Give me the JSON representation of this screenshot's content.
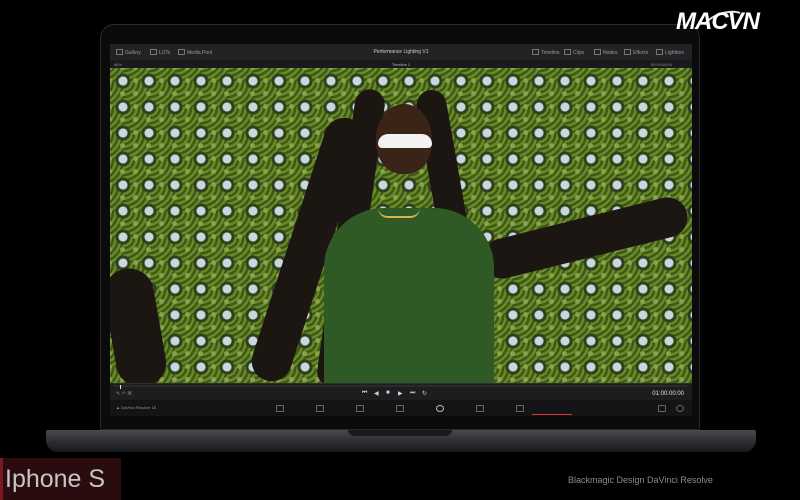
{
  "topbar": {
    "left_items": [
      "Gallery",
      "LUTs",
      "Media Pool"
    ],
    "title": "Performance Lighting V1",
    "right_items": [
      "Timeline",
      "Clips",
      "Nodes",
      "Effects",
      "Lightbox"
    ]
  },
  "viewer": {
    "zoom": "86%",
    "timeline_name": "Timeline 1",
    "timecode": "00:00:06:00"
  },
  "transport": {
    "timecode": "01:00:00:00",
    "buttons": [
      "⏮",
      "◀",
      "■",
      "▶",
      "⏭",
      "↻"
    ]
  },
  "pagebar": {
    "app_name": "DaVinci Resolve 18"
  },
  "branding": {
    "logo_mac": "MAC",
    "logo_vn": "VN",
    "iphone_badge": "Iphone S",
    "caption": "Blackmagic Design DaVinci Resolve"
  },
  "colors": {
    "accent": "#d23a3a",
    "background": "#000000"
  }
}
